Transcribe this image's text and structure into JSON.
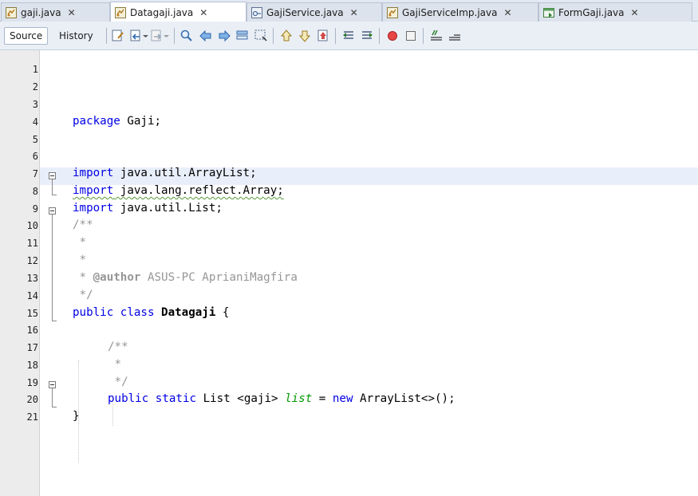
{
  "tabs": [
    {
      "label": "gaji.java",
      "icon": "java-file-icon",
      "active": false
    },
    {
      "label": "Datagaji.java",
      "icon": "java-file-icon",
      "active": true
    },
    {
      "label": "GajiService.java",
      "icon": "interface-file-icon",
      "active": false
    },
    {
      "label": "GajiServiceImp.java",
      "icon": "java-file-icon",
      "active": false
    },
    {
      "label": "FormGaji.java",
      "icon": "form-file-icon",
      "active": false
    }
  ],
  "tab_close_glyph": "✕",
  "toolbar": {
    "source_label": "Source",
    "history_label": "History"
  },
  "line_numbers": [
    "1",
    "2",
    "3",
    "4",
    "5",
    "6",
    "7",
    "8",
    "9",
    "10",
    "11",
    "12",
    "13",
    "14",
    "15",
    "16",
    "17",
    "18",
    "19",
    "20",
    "21"
  ],
  "code": {
    "l3_kw": "package",
    "l3_rest": " Gaji;",
    "l6_kw": "import",
    "l6_rest": " java.util.ArrayList;",
    "l7_kw": "import",
    "l7_rest": " java.lang.reflect.Array;",
    "l8_kw": "import",
    "l8_rest": " java.util.List;",
    "l9": "/**",
    "l10": " *",
    "l11": " *",
    "l12_star": " * ",
    "l12_tag": "@author",
    "l12_rest": " ASUS-PC AprianiMagfira",
    "l13": " */",
    "l14_kw": "public class",
    "l14_sp": " ",
    "l14_name": "Datagaji",
    "l14_rest": " {",
    "l16": "/**",
    "l17": " *",
    "l18": " */",
    "l19_kw1": "public static",
    "l19_a": " List <gaji> ",
    "l19_field": "list",
    "l19_b": " = ",
    "l19_kw2": "new",
    "l19_c": " ArrayList<>();",
    "l20": "}"
  },
  "colors": {
    "keyword": "#0000e6",
    "comment": "#969696",
    "field": "#009a00",
    "current_line": "#e9effa"
  }
}
